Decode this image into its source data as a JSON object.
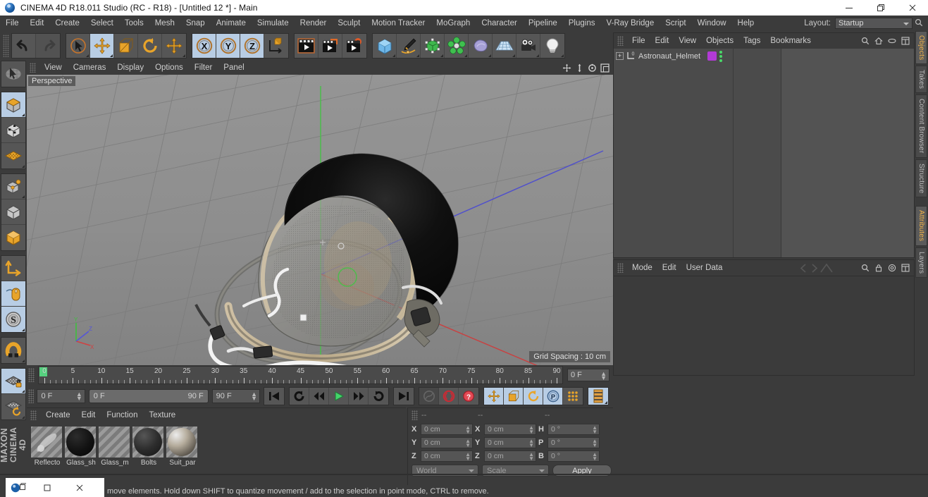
{
  "window": {
    "title": "CINEMA 4D R18.011 Studio (RC - R18) - [Untitled 12 *] - Main",
    "app_icon": "c4d-logo-icon",
    "minimize": "minimize-icon",
    "maximize": "restore-icon",
    "close": "close-icon"
  },
  "menubar": {
    "items": [
      "File",
      "Edit",
      "Create",
      "Select",
      "Tools",
      "Mesh",
      "Snap",
      "Animate",
      "Simulate",
      "Render",
      "Sculpt",
      "Motion Tracker",
      "MoGraph",
      "Character",
      "Pipeline",
      "Plugins",
      "V-Ray Bridge",
      "Script",
      "Window",
      "Help"
    ],
    "layout_label": "Layout:",
    "layout_value": "Startup",
    "search_icon": "search-icon"
  },
  "toolbar": {
    "groups": [
      {
        "name": "undo-redo",
        "buttons": [
          {
            "icon": "undo-icon",
            "label": "Undo",
            "state": "normal"
          },
          {
            "icon": "redo-icon",
            "label": "Redo",
            "state": "disabled"
          }
        ]
      },
      {
        "name": "transform-tools",
        "buttons": [
          {
            "icon": "live-selection-icon",
            "label": "Live Selection",
            "state": "active"
          },
          {
            "icon": "move-icon",
            "label": "Move",
            "state": "active"
          },
          {
            "icon": "scale-icon",
            "label": "Scale",
            "state": "normal"
          },
          {
            "icon": "rotate-icon",
            "label": "Rotate",
            "state": "normal"
          },
          {
            "icon": "move-alt-icon",
            "label": "Move (alt)",
            "state": "normal"
          }
        ]
      },
      {
        "name": "axis-locks",
        "buttons": [
          {
            "icon": "axis-x-icon",
            "label": "X Axis",
            "state": "active"
          },
          {
            "icon": "axis-y-icon",
            "label": "Y Axis",
            "state": "active"
          },
          {
            "icon": "axis-z-icon",
            "label": "Z Axis",
            "state": "active"
          },
          {
            "icon": "world-object-coord-icon",
            "label": "World/Object",
            "state": "normal"
          }
        ]
      },
      {
        "name": "render-tools",
        "buttons": [
          {
            "icon": "render-view-icon",
            "label": "Render View",
            "state": "normal"
          },
          {
            "icon": "render-picture-viewer-icon",
            "label": "Render to Picture Viewer",
            "state": "normal"
          },
          {
            "icon": "render-settings-icon",
            "label": "Edit Render Settings",
            "state": "normal"
          }
        ]
      },
      {
        "name": "create-objects",
        "buttons": [
          {
            "icon": "cube-primitive-icon",
            "label": "Add Cube Object",
            "state": "normal"
          },
          {
            "icon": "spline-pen-icon",
            "label": "Add Spline",
            "state": "normal"
          },
          {
            "icon": "generator-icon",
            "label": "Add NURBS Object",
            "state": "normal"
          },
          {
            "icon": "deformer-icon",
            "label": "Add Deformer",
            "state": "normal"
          },
          {
            "icon": "environment-icon",
            "label": "Add Scene Object",
            "state": "normal"
          },
          {
            "icon": "floor-grid-icon",
            "label": "Add Floor",
            "state": "normal"
          },
          {
            "icon": "camera-icon",
            "label": "Add Camera",
            "state": "normal"
          },
          {
            "icon": "light-icon",
            "label": "Add Light",
            "state": "normal"
          }
        ]
      }
    ]
  },
  "left_toolbar": {
    "groups": [
      {
        "buttons": [
          {
            "icon": "live-selection-tool-icon",
            "label": "Live Selection",
            "state": "normal"
          }
        ]
      },
      {
        "buttons": [
          {
            "icon": "model-mode-icon",
            "label": "Model Mode",
            "state": "active"
          },
          {
            "icon": "texture-mode-icon",
            "label": "Texture Mode",
            "state": "normal"
          },
          {
            "icon": "points-mode-icon",
            "label": "Points Mode",
            "state": "normal"
          }
        ]
      },
      {
        "buttons": [
          {
            "icon": "object-axis-icon",
            "label": "Enable Axis Modification",
            "state": "normal"
          },
          {
            "icon": "object-mode-icon",
            "label": "Object Mode",
            "state": "normal"
          },
          {
            "icon": "world-axis-icon",
            "label": "World Axis",
            "state": "normal"
          }
        ]
      },
      {
        "buttons": [
          {
            "icon": "coordinate-system-icon",
            "label": "Coordinate System",
            "state": "normal"
          },
          {
            "icon": "mouse-viewport-icon",
            "label": "Viewport Solo",
            "state": "active"
          },
          {
            "icon": "snap-s-icon",
            "label": "Enable Snapping",
            "state": "active"
          }
        ]
      },
      {
        "buttons": [
          {
            "icon": "magnet-icon",
            "label": "Magnet",
            "state": "normal"
          }
        ]
      },
      {
        "buttons": [
          {
            "icon": "lock-workplane-icon",
            "label": "Lock Workplane",
            "state": "active"
          },
          {
            "icon": "planar-workplane-icon",
            "label": "Workplane Mode",
            "state": "normal"
          }
        ]
      }
    ],
    "brand_line1": "MAXON",
    "brand_line2": "CINEMA 4D"
  },
  "viewport": {
    "menu": [
      "View",
      "Cameras",
      "Display",
      "Options",
      "Filter",
      "Panel"
    ],
    "corner_icons": [
      "pan-view-icon",
      "zoom-view-icon",
      "rotate-view-icon",
      "maximize-view-icon"
    ],
    "view_label": "Perspective",
    "grid_spacing": "Grid Spacing : 10 cm",
    "axis_gizmo": {
      "x": "X",
      "y": "Y",
      "z": "Z"
    },
    "scene_object": "Astronaut helmet 3D model"
  },
  "timeline": {
    "labels": [
      "0",
      "5",
      "10",
      "15",
      "20",
      "25",
      "30",
      "35",
      "40",
      "45",
      "50",
      "55",
      "60",
      "65",
      "70",
      "75",
      "80",
      "85",
      "90"
    ],
    "min_frame": 0,
    "max_frame": 90,
    "current_frame": "0 F"
  },
  "transport": {
    "current_field": "0 F",
    "range_start": "0 F",
    "range_end": "90 F",
    "end_field": "90 F",
    "buttons": [
      {
        "icon": "go-to-start-icon",
        "label": "Go to Start",
        "state": "normal"
      },
      {
        "icon": "play-reverse-loop-icon",
        "label": "Play Backwards",
        "state": "normal"
      },
      {
        "icon": "step-back-icon",
        "label": "Previous Frame",
        "state": "normal"
      },
      {
        "icon": "play-icon",
        "label": "Play",
        "state": "normal"
      },
      {
        "icon": "step-forward-icon",
        "label": "Next Frame",
        "state": "normal"
      },
      {
        "icon": "play-forward-loop-icon",
        "label": "Loop",
        "state": "normal"
      },
      {
        "icon": "go-to-end-icon",
        "label": "Go to End",
        "state": "normal"
      },
      {
        "icon": "record-active-objects-icon",
        "label": "Record Active Objects",
        "state": "disabled"
      },
      {
        "icon": "autokeying-icon",
        "label": "Autokeying",
        "state": "normal"
      },
      {
        "icon": "keyframe-selection-icon",
        "label": "Keyframe Selection",
        "state": "normal"
      },
      {
        "icon": "key-position-icon",
        "label": "Position",
        "state": "active"
      },
      {
        "icon": "key-scale-icon",
        "label": "Scale",
        "state": "active"
      },
      {
        "icon": "key-rotation-icon",
        "label": "Rotation",
        "state": "active"
      },
      {
        "icon": "key-parameter-icon",
        "label": "Parameter",
        "state": "active"
      },
      {
        "icon": "key-pla-icon",
        "label": "Point Level Animation",
        "state": "normal"
      },
      {
        "icon": "timeline-panel-icon",
        "label": "Timeline",
        "state": "active"
      }
    ]
  },
  "material_manager": {
    "menu": [
      "Create",
      "Edit",
      "Function",
      "Texture"
    ],
    "materials": [
      {
        "name": "Reflecto",
        "color": "#7d7d7d",
        "type": "reflective"
      },
      {
        "name": "Glass_sh",
        "color": "#171717",
        "type": "dark"
      },
      {
        "name": "Glass_m",
        "color": "transparent",
        "type": "checker"
      },
      {
        "name": "Bolts",
        "color": "#3a3a3a",
        "type": "dark"
      },
      {
        "name": "Suit_par",
        "color": "#9c958b",
        "type": "textured"
      }
    ]
  },
  "coordinates": {
    "headers": [
      "--",
      "--",
      "--"
    ],
    "rows": [
      {
        "pos_label": "X",
        "pos_value": "0 cm",
        "size_label": "X",
        "size_value": "0 cm",
        "rot_label": "H",
        "rot_value": "0 °"
      },
      {
        "pos_label": "Y",
        "pos_value": "0 cm",
        "size_label": "Y",
        "size_value": "0 cm",
        "rot_label": "P",
        "rot_value": "0 °"
      },
      {
        "pos_label": "Z",
        "pos_value": "0 cm",
        "size_label": "Z",
        "size_value": "0 cm",
        "rot_label": "B",
        "rot_value": "0 °"
      }
    ],
    "system": "World",
    "mode": "Scale",
    "apply": "Apply"
  },
  "object_manager": {
    "menu": [
      "File",
      "Edit",
      "View",
      "Objects",
      "Tags",
      "Bookmarks"
    ],
    "header_icons": [
      "search-icon",
      "home-icon",
      "link-icon",
      "layout-icon"
    ],
    "objects": [
      {
        "name": "Astronaut_Helmet",
        "expander": "+",
        "type_icon": "null-object-icon",
        "tags": [
          {
            "name": "material-tag",
            "color": "#b23ad6"
          },
          {
            "name": "visibility-dots-icon",
            "color": "#49d96a"
          }
        ]
      }
    ]
  },
  "attribute_manager": {
    "menu": [
      "Mode",
      "Edit",
      "User Data"
    ],
    "header_icons": [
      "search-icon",
      "lock-icon",
      "target-icon",
      "layout-icon"
    ]
  },
  "right_tabs": {
    "upper": [
      {
        "label": "Objects",
        "active": true
      },
      {
        "label": "Takes",
        "active": false
      },
      {
        "label": "Content Browser",
        "active": false
      },
      {
        "label": "Structure",
        "active": false
      }
    ],
    "lower": [
      {
        "label": "Attributes",
        "active": true
      },
      {
        "label": "Layers",
        "active": false
      }
    ]
  },
  "statusbar": {
    "message": "move elements. Hold down SHIFT to quantize movement / add to the selection in point mode, CTRL to remove."
  },
  "taskbar_popup": {
    "icons": [
      "c4d-taskbar-icon",
      "restore-window-icon",
      "maximize-window-icon",
      "close-window-icon"
    ]
  },
  "colors": {
    "panel_bg": "#3b3b3b",
    "button_bg": "#565656",
    "active_blue": "#b8cde4",
    "orange": "#e2901f",
    "accent_text": "#f0b34a",
    "viewport_bg": "#8d8d8d"
  }
}
